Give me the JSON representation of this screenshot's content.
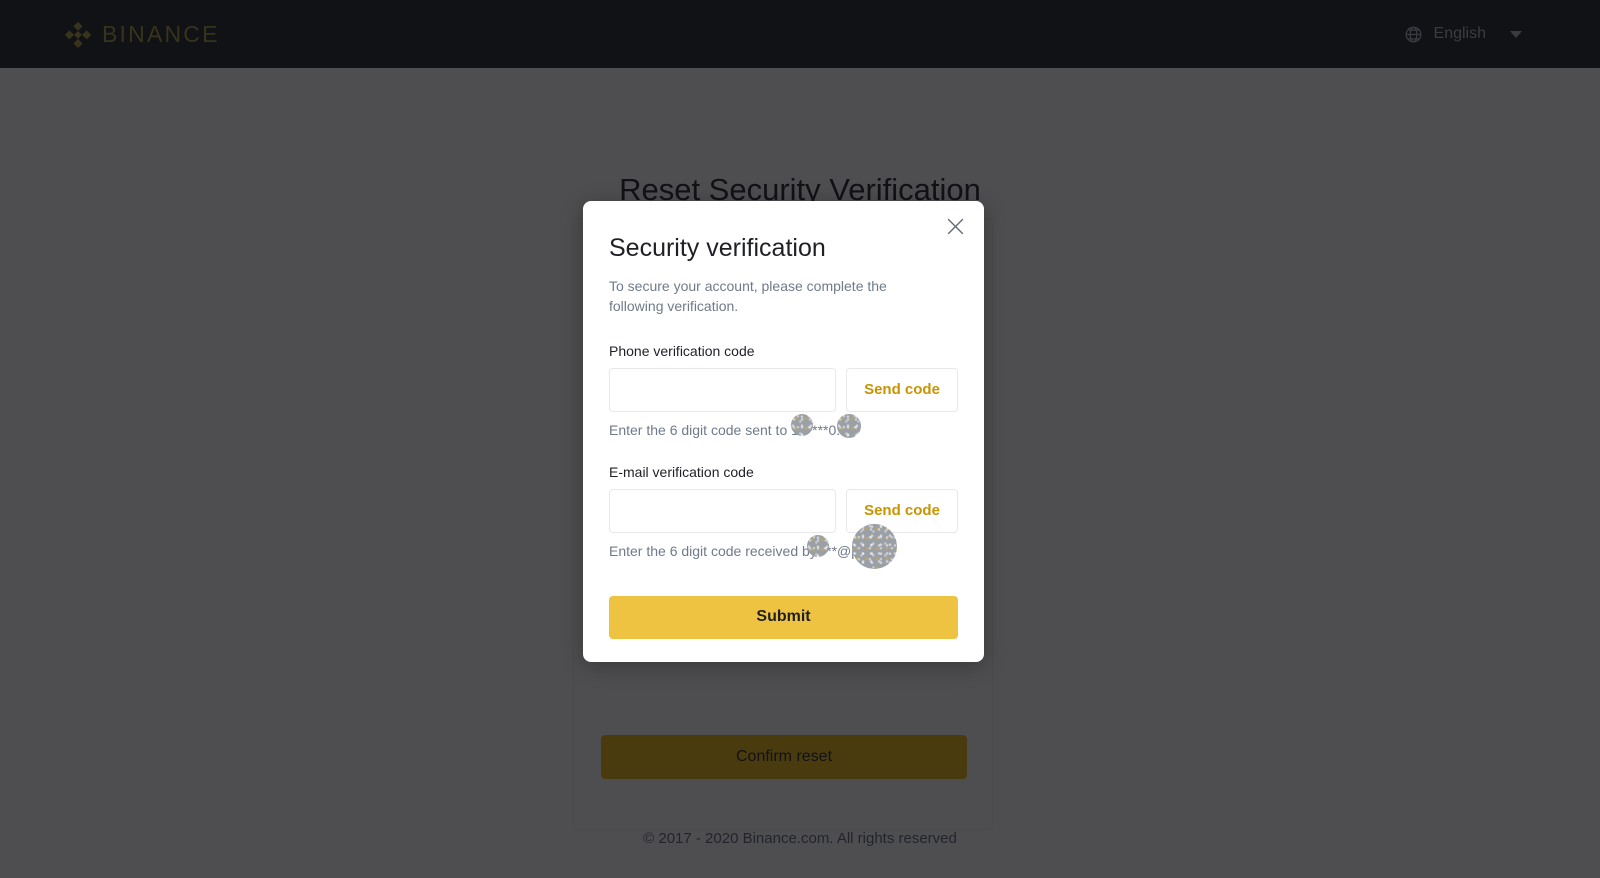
{
  "header": {
    "logo_text": "BINANCE",
    "logo_icon": "binance-diamond-icon",
    "language_icon": "globe-icon",
    "language_label": "English",
    "caret_icon": "chevron-down-icon"
  },
  "page": {
    "title": "Reset Security Verification",
    "confirm_button": "Confirm reset",
    "footer": "© 2017 - 2020 Binance.com. All rights reserved"
  },
  "modal": {
    "close_icon": "close-icon",
    "title": "Security verification",
    "subtitle": "To secure your account, please complete the following verification.",
    "phone": {
      "label": "Phone verification code",
      "input_value": "",
      "input_placeholder": "",
      "send_code_label": "Send code",
      "hint_prefix": "Enter the 6 digit code sent to 13",
      "hint_middle": "****",
      "hint_suffix": "0."
    },
    "email": {
      "label": "E-mail verification code",
      "input_value": "",
      "input_placeholder": "",
      "send_code_label": "Send code",
      "hint_prefix": "Enter the 6 digit code received by ",
      "hint_middle": "***@",
      "hint_suffix": "p.com."
    },
    "submit_label": "Submit"
  },
  "colors": {
    "brand_yellow": "#f0b90b",
    "submit_yellow": "#eec342",
    "send_code_text": "#c99400",
    "header_bg": "#131418",
    "overlay": "#434549",
    "text_primary": "#1e2026",
    "text_secondary": "#707a8a"
  }
}
